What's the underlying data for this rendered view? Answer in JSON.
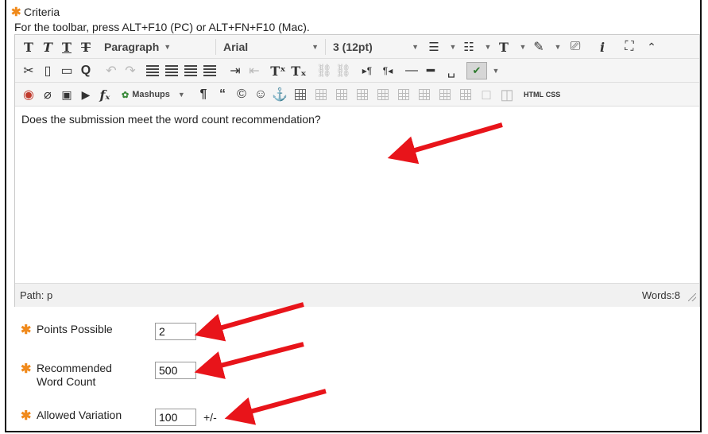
{
  "criteria": {
    "label": "Criteria",
    "toolbar_hint": "For the toolbar, press ALT+F10 (PC) or ALT+FN+F10 (Mac)."
  },
  "toolbar": {
    "format_select": "Paragraph",
    "font_select": "Arial",
    "size_select": "3 (12pt)",
    "mashups_label": "Mashups",
    "html_label": "HTML",
    "css_label": "CSS"
  },
  "editor": {
    "content": "Does the submission meet the word count recommendation?",
    "path": "Path: p",
    "words": "Words:8"
  },
  "fields": {
    "points_label": "Points Possible",
    "points_value": "2",
    "wc_label_line1": "Recommended",
    "wc_label_line2": "Word Count",
    "wc_value": "500",
    "variation_label": "Allowed Variation",
    "variation_value": "100",
    "variation_suffix": "+/-"
  },
  "colors": {
    "required_star": "#f08a1c",
    "arrow": "#e8141a"
  }
}
